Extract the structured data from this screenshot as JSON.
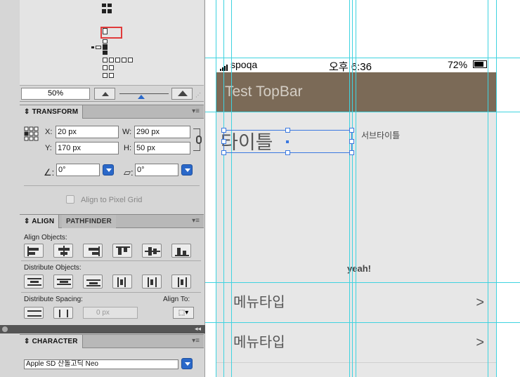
{
  "navigator": {
    "zoom": "50%"
  },
  "transform": {
    "tab": "TRANSFORM",
    "x_label": "X:",
    "x": "20 px",
    "y_label": "Y:",
    "y": "170 px",
    "w_label": "W:",
    "w": "290 px",
    "h_label": "H:",
    "h": "50 px",
    "angle": "0°",
    "shear": "0°",
    "align_pixel": "Align to Pixel Grid"
  },
  "align": {
    "tab": "ALIGN",
    "tab2": "PATHFINDER",
    "objects_label": "Align Objects:",
    "distribute_label": "Distribute Objects:",
    "spacing_label": "Distribute Spacing:",
    "align_to_label": "Align To:",
    "spacing_value": "0 px"
  },
  "character": {
    "tab": "CHARACTER",
    "font": "Apple SD 산돌고딕 Neo"
  },
  "screen": {
    "carrier": "spoqa",
    "time": "오후 6:36",
    "battery": "72%",
    "topbar_title": "Test TopBar",
    "title": "타이틀",
    "subtitle": "서브타이틀",
    "body": "yeah!",
    "menu": [
      {
        "label": "메뉴타입",
        "chevron": ">"
      },
      {
        "label": "메뉴타입",
        "chevron": ">"
      }
    ]
  },
  "colors": {
    "topbar": "#7b6a57",
    "guide": "#3fd3e0",
    "selection": "#3a78e0",
    "dropdown": "#2a68c9"
  }
}
